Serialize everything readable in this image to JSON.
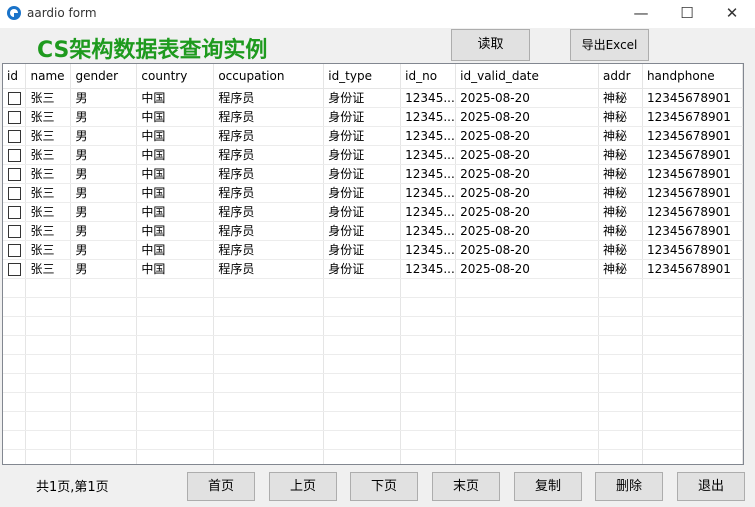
{
  "window": {
    "title": "aardio form",
    "minimize": "—",
    "maximize": "☐",
    "close": "✕"
  },
  "headline": "CS架构数据表查询实例",
  "toolbar": {
    "read_label": "读取",
    "export_label": "导出Excel"
  },
  "table": {
    "columns": [
      "id",
      "name",
      "gender",
      "country",
      "occupation",
      "id_type",
      "id_no",
      "id_valid_date",
      "addr",
      "handphone"
    ],
    "rows": [
      {
        "name": "张三",
        "gender": "男",
        "country": "中国",
        "occupation": "程序员",
        "id_type": "身份证",
        "id_no": "12345...",
        "id_valid_date": "2025-08-20",
        "addr": "神秘",
        "handphone": "12345678901"
      },
      {
        "name": "张三",
        "gender": "男",
        "country": "中国",
        "occupation": "程序员",
        "id_type": "身份证",
        "id_no": "12345...",
        "id_valid_date": "2025-08-20",
        "addr": "神秘",
        "handphone": "12345678901"
      },
      {
        "name": "张三",
        "gender": "男",
        "country": "中国",
        "occupation": "程序员",
        "id_type": "身份证",
        "id_no": "12345...",
        "id_valid_date": "2025-08-20",
        "addr": "神秘",
        "handphone": "12345678901"
      },
      {
        "name": "张三",
        "gender": "男",
        "country": "中国",
        "occupation": "程序员",
        "id_type": "身份证",
        "id_no": "12345...",
        "id_valid_date": "2025-08-20",
        "addr": "神秘",
        "handphone": "12345678901"
      },
      {
        "name": "张三",
        "gender": "男",
        "country": "中国",
        "occupation": "程序员",
        "id_type": "身份证",
        "id_no": "12345...",
        "id_valid_date": "2025-08-20",
        "addr": "神秘",
        "handphone": "12345678901"
      },
      {
        "name": "张三",
        "gender": "男",
        "country": "中国",
        "occupation": "程序员",
        "id_type": "身份证",
        "id_no": "12345...",
        "id_valid_date": "2025-08-20",
        "addr": "神秘",
        "handphone": "12345678901"
      },
      {
        "name": "张三",
        "gender": "男",
        "country": "中国",
        "occupation": "程序员",
        "id_type": "身份证",
        "id_no": "12345...",
        "id_valid_date": "2025-08-20",
        "addr": "神秘",
        "handphone": "12345678901"
      },
      {
        "name": "张三",
        "gender": "男",
        "country": "中国",
        "occupation": "程序员",
        "id_type": "身份证",
        "id_no": "12345...",
        "id_valid_date": "2025-08-20",
        "addr": "神秘",
        "handphone": "12345678901"
      },
      {
        "name": "张三",
        "gender": "男",
        "country": "中国",
        "occupation": "程序员",
        "id_type": "身份证",
        "id_no": "12345...",
        "id_valid_date": "2025-08-20",
        "addr": "神秘",
        "handphone": "12345678901"
      },
      {
        "name": "张三",
        "gender": "男",
        "country": "中国",
        "occupation": "程序员",
        "id_type": "身份证",
        "id_no": "12345...",
        "id_valid_date": "2025-08-20",
        "addr": "神秘",
        "handphone": "12345678901"
      }
    ]
  },
  "footer": {
    "page_info": "共1页,第1页",
    "first_label": "首页",
    "prev_label": "上页",
    "next_label": "下页",
    "last_label": "末页",
    "copy_label": "复制",
    "delete_label": "删除",
    "exit_label": "退出"
  },
  "colors": {
    "headline": "#1e9a1e",
    "app_icon": "#1a73c9"
  },
  "icons": {
    "app": "aardio-app-icon",
    "minimize": "minimize-icon",
    "maximize": "maximize-icon",
    "close": "close-icon"
  }
}
